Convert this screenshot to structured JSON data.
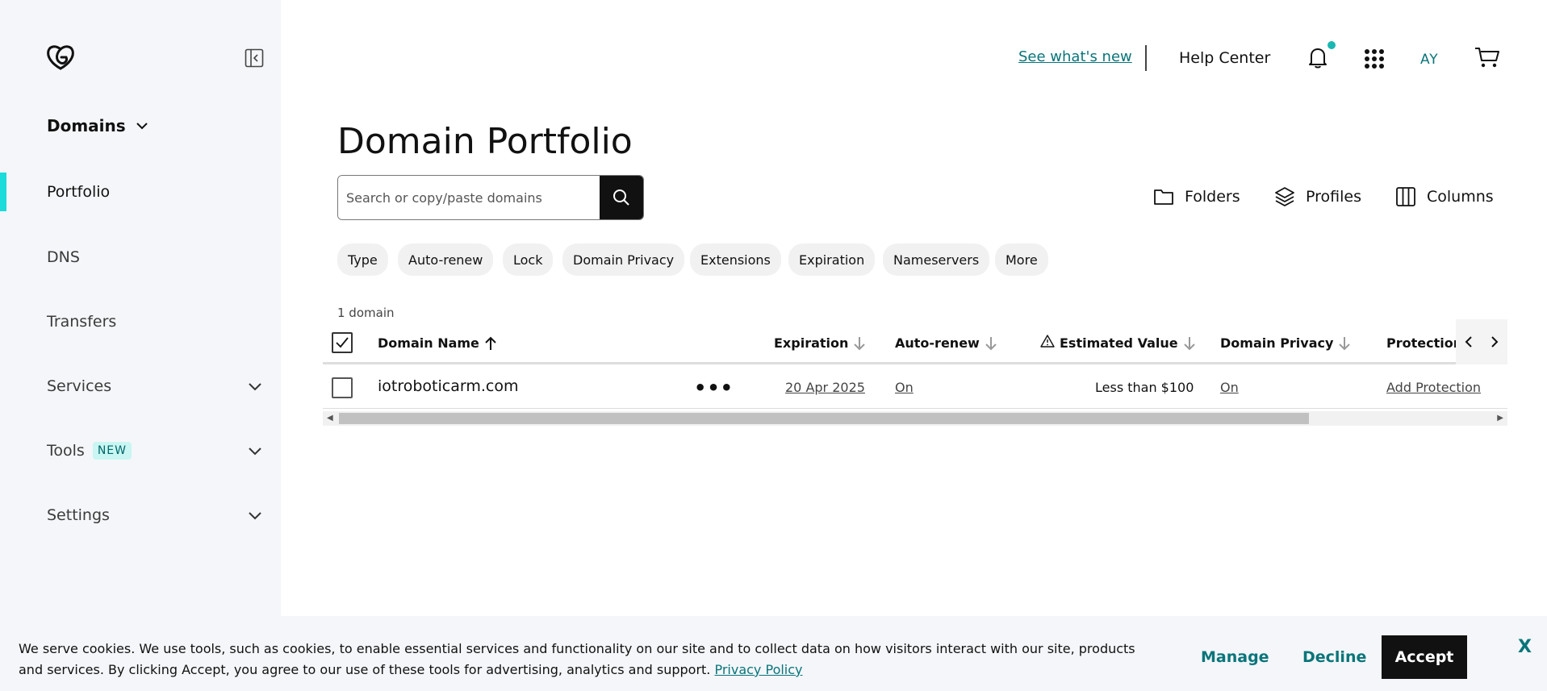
{
  "sidebar": {
    "heading": "Domains",
    "items": [
      {
        "label": "Portfolio"
      },
      {
        "label": "DNS"
      },
      {
        "label": "Transfers"
      },
      {
        "label": "Services"
      },
      {
        "label": "Tools",
        "badge": "NEW"
      },
      {
        "label": "Settings"
      }
    ]
  },
  "topbar": {
    "whats_new": "See what's new",
    "help": "Help Center",
    "avatar_initials": "AY"
  },
  "main": {
    "title": "Domain Portfolio",
    "search_placeholder": "Search or copy/paste domains",
    "toolbar": {
      "folders": "Folders",
      "profiles": "Profiles",
      "columns": "Columns"
    },
    "filters": [
      "Type",
      "Auto-renew",
      "Lock",
      "Domain Privacy",
      "Extensions",
      "Expiration",
      "Nameservers",
      "More"
    ],
    "count": "1 domain",
    "columns": {
      "domain_name": "Domain Name",
      "expiration": "Expiration",
      "auto_renew": "Auto-renew",
      "estimated_value": "Estimated Value",
      "domain_privacy": "Domain Privacy",
      "protection": "Protection"
    },
    "rows": [
      {
        "domain": "iotroboticarm.com",
        "actions": "•••",
        "expiration": "20 Apr 2025",
        "auto_renew": "On",
        "estimated_value": "Less than $100",
        "domain_privacy": "On",
        "protection": "Add Protection"
      }
    ]
  },
  "cookie": {
    "text": "We serve cookies. We use tools, such as cookies, to enable essential services and functionality on our site and to collect data on how visitors interact with our site, products and services. By clicking Accept, you agree to our use of these tools for advertising, analytics and support.",
    "privacy_link": "Privacy Policy",
    "manage": "Manage",
    "decline": "Decline",
    "accept": "Accept",
    "close": "X"
  },
  "colors": {
    "accent_teal": "#09757a",
    "active_bar": "#1bdbdb",
    "sidebar_bg": "#f4f6f9"
  }
}
